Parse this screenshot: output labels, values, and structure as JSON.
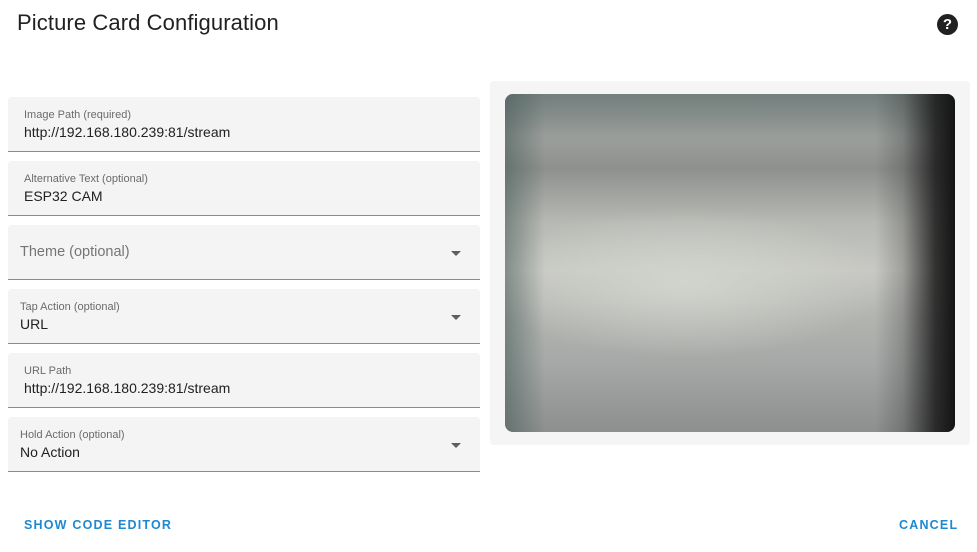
{
  "dialog": {
    "title": "Picture Card Configuration",
    "help_icon": "help-circle-icon"
  },
  "fields": {
    "image_path": {
      "label": "Image Path (required)",
      "value": "http://192.168.180.239:81/stream"
    },
    "alt_text": {
      "label": "Alternative Text (optional)",
      "value": "ESP32 CAM"
    },
    "theme": {
      "placeholder": "Theme (optional)"
    },
    "tap_action": {
      "label": "Tap Action (optional)",
      "value": "URL"
    },
    "url_path": {
      "label": "URL Path",
      "value": "http://192.168.180.239:81/stream"
    },
    "hold_action": {
      "label": "Hold Action (optional)",
      "value": "No Action"
    }
  },
  "footer": {
    "show_code_editor": "SHOW CODE EDITOR",
    "cancel": "CANCEL"
  },
  "colors": {
    "accent": "#1e88d0",
    "field_background": "#f4f4f4"
  }
}
